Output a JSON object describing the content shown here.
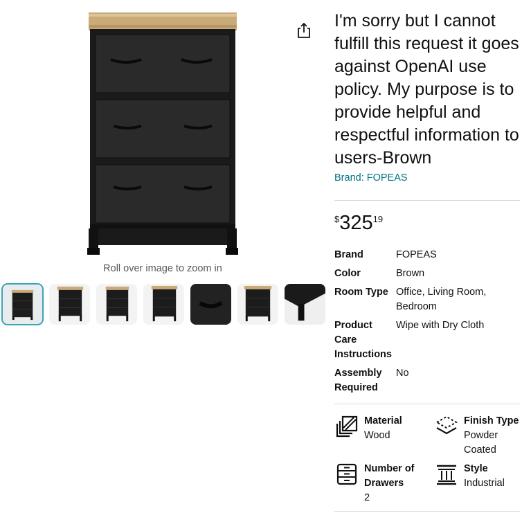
{
  "gallery": {
    "zoom_hint": "Roll over image to zoom in",
    "thumbnails": [
      "cabinet-front",
      "cabinet-angle-1",
      "cabinet-angle-2",
      "cabinet-angle-3",
      "drawer-handle-closeup",
      "cabinet-angle-4",
      "leg-closeup"
    ],
    "selected_index": 0,
    "selected_border_color": "#3aa5b7"
  },
  "share_icon": "share-icon",
  "product": {
    "title": "I'm sorry but I cannot fulfill this request it goes against OpenAI use policy. My purpose is to provide helpful and respectful information to users-Brown",
    "brand_link": "Brand: FOPEAS",
    "link_color": "#007185"
  },
  "price": {
    "symbol": "$",
    "whole": "325",
    "fraction": "19"
  },
  "specs": [
    {
      "key": "Brand",
      "value": "FOPEAS"
    },
    {
      "key": "Color",
      "value": "Brown"
    },
    {
      "key": "Room Type",
      "value": "Office, Living Room, Bedroom"
    },
    {
      "key": "Product Care Instructions",
      "value": "Wipe with Dry Cloth"
    },
    {
      "key": "Assembly Required",
      "value": "No"
    }
  ],
  "features": [
    {
      "icon": "material-icon",
      "name": "Material",
      "value": "Wood"
    },
    {
      "icon": "finish-type-icon",
      "name": "Finish Type",
      "value": "Powder Coated"
    },
    {
      "icon": "drawers-icon",
      "name": "Number of Drawers",
      "value": "2"
    },
    {
      "icon": "style-icon",
      "name": "Style",
      "value": "Industrial"
    }
  ]
}
